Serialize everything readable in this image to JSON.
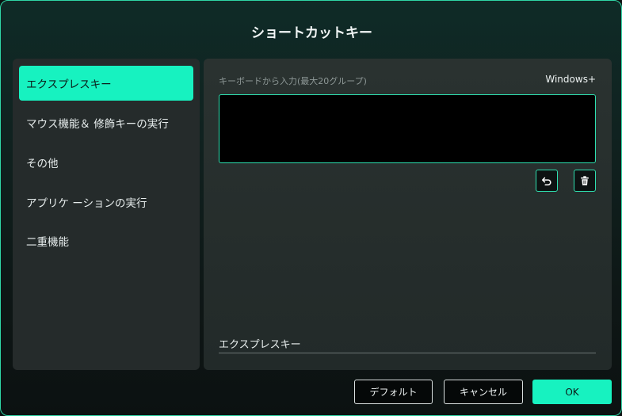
{
  "dialog": {
    "title": "ショートカットキー"
  },
  "sidebar": {
    "items": [
      {
        "label": "エクスプレスキー",
        "active": true
      },
      {
        "label": "マウス機能＆ 修飾キーの実行",
        "active": false
      },
      {
        "label": "その他",
        "active": false
      },
      {
        "label": "アプリケ ーションの実行",
        "active": false
      },
      {
        "label": "二重機能",
        "active": false
      }
    ]
  },
  "panel": {
    "input_label": "キーボードから入力(最大20グループ)",
    "modifier_label": "Windows+",
    "keybox_value": "",
    "undo_icon": "undo-icon",
    "delete_icon": "trash-icon",
    "name_field_value": "エクスプレスキー"
  },
  "footer": {
    "default_label": "デフォルト",
    "cancel_label": "キャンセル",
    "ok_label": "OK"
  },
  "colors": {
    "accent": "#17f2c0",
    "border": "#2ee0b0"
  }
}
